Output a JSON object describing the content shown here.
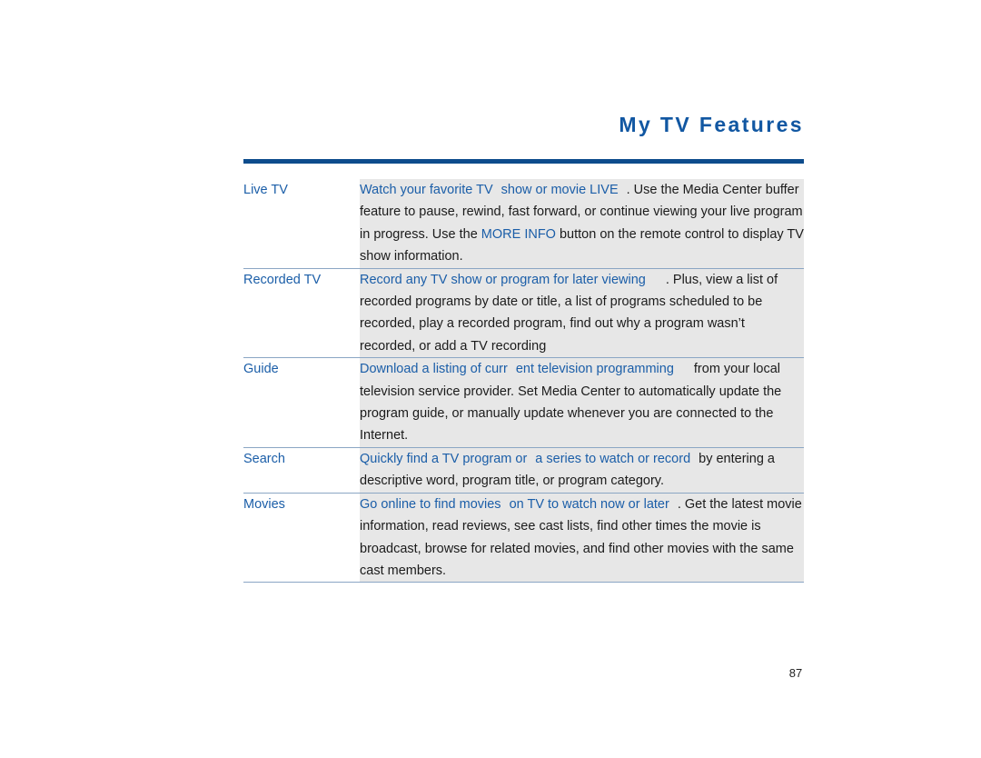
{
  "document": {
    "title": "My TV Features",
    "page_number": "87",
    "accent_color": "#1157a2",
    "rule_color": "#0d4c8c",
    "highlight_color": "#1b5ea8",
    "cell_background": "#e7e7e7",
    "row_divider_color": "#8ba6c4"
  },
  "table": {
    "rows": [
      {
        "label": "Live TV",
        "segments": [
          {
            "text": "Watch your favorite TV",
            "style": "highlight"
          },
          {
            "text": " ",
            "style": "gap"
          },
          {
            "text": "show or movie LIVE",
            "style": "highlight"
          },
          {
            "text": " ",
            "style": "gap"
          },
          {
            "text": ". Use the Media Center buffer feature to pause, rewind, fast forward, or continue viewing your live program in progress. Use the ",
            "style": "plain"
          },
          {
            "text": "MORE INFO",
            "style": "highlight"
          },
          {
            "text": " button on the remote control to display TV show information.",
            "style": "plain"
          }
        ]
      },
      {
        "label": "Recorded TV",
        "segments": [
          {
            "text": "Record any TV show or program for later viewing",
            "style": "highlight"
          },
          {
            "text": " ",
            "style": "gap-wide"
          },
          {
            "text": ". Plus, view a list of recorded programs by date or title, a list of programs scheduled to be recorded, play a recorded program, find out why a program wasn’t recorded, or add a TV recording",
            "style": "plain"
          }
        ]
      },
      {
        "label": "Guide",
        "segments": [
          {
            "text": "Download a listing of curr",
            "style": "highlight"
          },
          {
            "text": " ",
            "style": "gap"
          },
          {
            "text": "ent television programming",
            "style": "highlight"
          },
          {
            "text": " ",
            "style": "gap-wide"
          },
          {
            "text": "from your local television service provider. Set Media Center to automatically update the program guide, or manually update whenever you are connected to the Internet.",
            "style": "plain"
          }
        ]
      },
      {
        "label": "Search",
        "segments": [
          {
            "text": "Quickly find a TV program or",
            "style": "highlight"
          },
          {
            "text": " ",
            "style": "gap"
          },
          {
            "text": "a series to watch or record",
            "style": "highlight"
          },
          {
            "text": " ",
            "style": "gap"
          },
          {
            "text": "by entering a descriptive word, program title, or program category.",
            "style": "plain"
          }
        ]
      },
      {
        "label": "Movies",
        "segments": [
          {
            "text": "Go online to find movies",
            "style": "highlight"
          },
          {
            "text": " ",
            "style": "gap"
          },
          {
            "text": "on TV to watch now or later",
            "style": "highlight"
          },
          {
            "text": " ",
            "style": "gap"
          },
          {
            "text": ". Get the latest movie information, read reviews, see cast lists, find other times the movie is broadcast, browse for related movies, and find other movies with the same cast members.",
            "style": "plain"
          }
        ]
      }
    ]
  }
}
